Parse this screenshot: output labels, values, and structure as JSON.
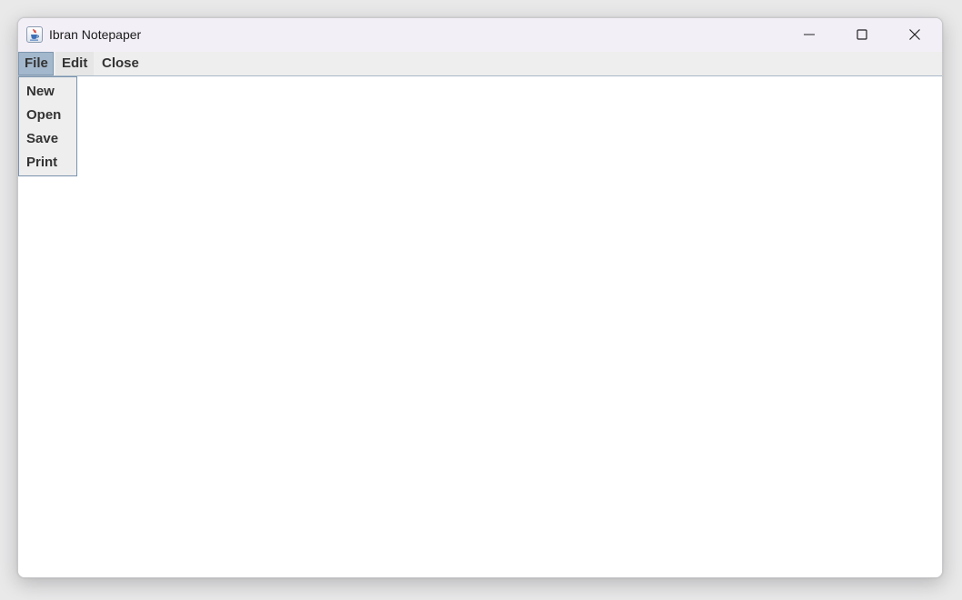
{
  "window": {
    "title": "Ibran Notepaper",
    "app_icon": "java-cup-icon",
    "controls": {
      "minimize": "minimize-icon",
      "maximize": "maximize-icon",
      "close": "close-icon"
    }
  },
  "menubar": {
    "items": [
      {
        "label": "File",
        "active": true
      },
      {
        "label": "Edit",
        "active": false
      },
      {
        "label": "Close",
        "active": false
      }
    ]
  },
  "file_menu": {
    "items": [
      {
        "label": "New"
      },
      {
        "label": "Open"
      },
      {
        "label": "Save"
      },
      {
        "label": "Print"
      }
    ]
  },
  "editor": {
    "text": ""
  },
  "colors": {
    "titlebar": "#f3eff7",
    "menubar": "#eeeeee",
    "active_menu": "#a3b8cc",
    "menu_border": "#7a93ad",
    "text": "#333333"
  }
}
